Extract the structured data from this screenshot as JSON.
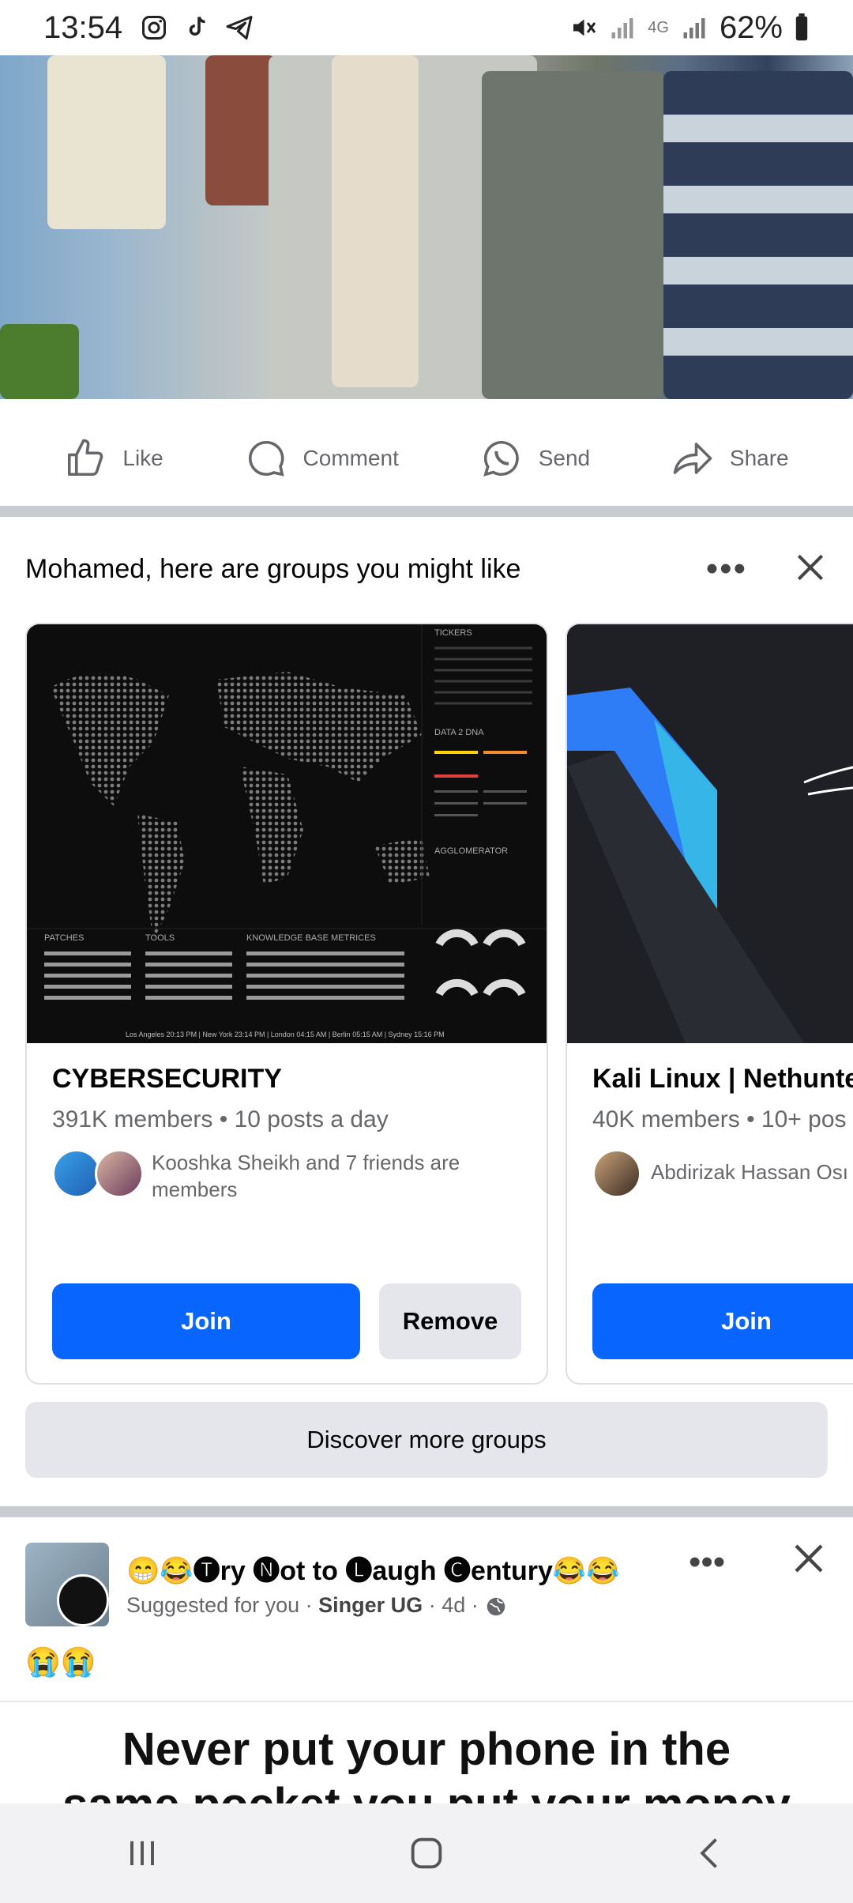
{
  "status": {
    "time": "13:54",
    "network": "4G",
    "battery": "62%"
  },
  "actions": {
    "like": "Like",
    "comment": "Comment",
    "send": "Send",
    "share": "Share"
  },
  "groups": {
    "title": "Mohamed, here are groups you might like",
    "cards": [
      {
        "name": "CYBERSECURITY",
        "meta": "391K members • 10 posts a day",
        "friends": "Kooshka Sheikh and 7 friends are members",
        "join": "Join",
        "remove": "Remove",
        "image_labels": [
          "TICKERS",
          "DATA 2 DNA",
          "AGGLOMERATOR",
          "PATCHES",
          "TOOLS",
          "KNOWLEDGE BASE METRICES"
        ],
        "clock_line": "Los Angeles 20:13 PM  |  New York 23:14 PM  |  London 04:15 AM  |  Berlin 05:15 AM  |  Sydney 15:16 PM"
      },
      {
        "name": "Kali Linux | Nethunte",
        "meta": "40K members • 10+ pos",
        "friends": "Abdirizak Hassan Osı",
        "join": "Join"
      }
    ],
    "discover": "Discover more groups"
  },
  "post": {
    "title": "😁😂🅣ry 🅝ot to 🅛augh 🅒entury😂😂",
    "suggested": "Suggested for you",
    "author": "Singer UG",
    "age": "4d",
    "emoji": "😭😭",
    "meme_line1": "Never put your phone in the",
    "meme_line2": "same pocket you put your money"
  }
}
